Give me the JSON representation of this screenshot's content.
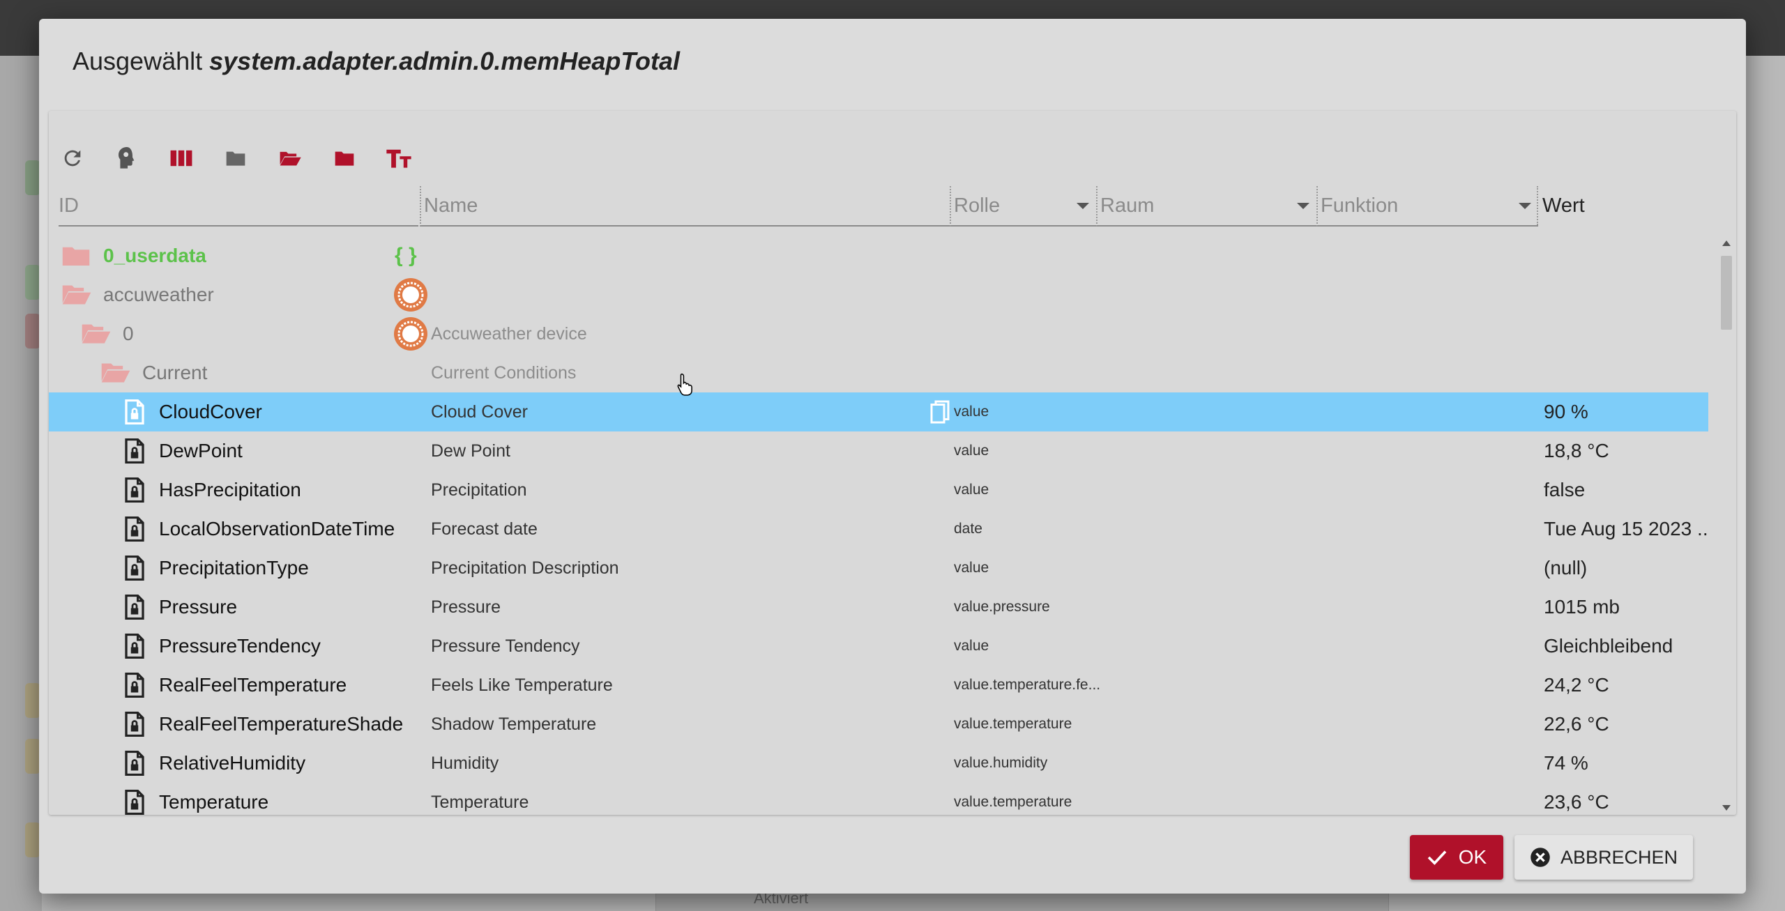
{
  "dialog": {
    "title_prefix": "Ausgewählt",
    "title_id": "system.adapter.admin.0.memHeapTotal"
  },
  "toolbar": {
    "icons": [
      "refresh-icon",
      "expert-mode-icon",
      "columns-icon",
      "folder-closed-icon",
      "folder-open-icon",
      "folder-filled-icon",
      "text-size-icon"
    ]
  },
  "columns": {
    "id": "ID",
    "name": "Name",
    "role": "Rolle",
    "room": "Raum",
    "function": "Funktion",
    "value": "Wert"
  },
  "rows": [
    {
      "id": "0_userdata",
      "name": "",
      "role": "",
      "value": ""
    },
    {
      "id": "accuweather",
      "name": "",
      "role": "",
      "value": ""
    },
    {
      "id": "0",
      "name": "Accuweather device",
      "role": "",
      "value": ""
    },
    {
      "id": "Current",
      "name": "Current Conditions",
      "role": "",
      "value": ""
    },
    {
      "id": "CloudCover",
      "name": "Cloud Cover",
      "role": "value",
      "value": "90 %"
    },
    {
      "id": "DewPoint",
      "name": "Dew Point",
      "role": "value",
      "value": "18,8 °C"
    },
    {
      "id": "HasPrecipitation",
      "name": "Precipitation",
      "role": "value",
      "value": "false"
    },
    {
      "id": "LocalObservationDateTime",
      "name": "Forecast date",
      "role": "date",
      "value": "Tue Aug 15 2023 ..."
    },
    {
      "id": "PrecipitationType",
      "name": "Precipitation Description",
      "role": "value",
      "value": "(null)"
    },
    {
      "id": "Pressure",
      "name": "Pressure",
      "role": "value.pressure",
      "value": "1015 mb"
    },
    {
      "id": "PressureTendency",
      "name": "Pressure Tendency",
      "role": "value",
      "value": "Gleichbleibend"
    },
    {
      "id": "RealFeelTemperature",
      "name": "Feels Like Temperature",
      "role": "value.temperature.fe...",
      "value": "24,2 °C"
    },
    {
      "id": "RealFeelTemperatureShade",
      "name": "Shadow Temperature",
      "role": "value.temperature",
      "value": "22,6 °C"
    },
    {
      "id": "RelativeHumidity",
      "name": "Humidity",
      "role": "value.humidity",
      "value": "74 %"
    },
    {
      "id": "Temperature",
      "name": "Temperature",
      "role": "value.temperature",
      "value": "23,6 °C"
    }
  ],
  "buttons": {
    "ok": "OK",
    "cancel": "ABBRECHEN"
  },
  "background": {
    "status_text": "Aktiviert"
  },
  "colors": {
    "accent": "#b0112a",
    "selected_row": "#7ecdf9",
    "userdata_green": "#5cc24a",
    "adapter_orange": "#e07a45",
    "folder_pink": "#e8a5a5"
  }
}
